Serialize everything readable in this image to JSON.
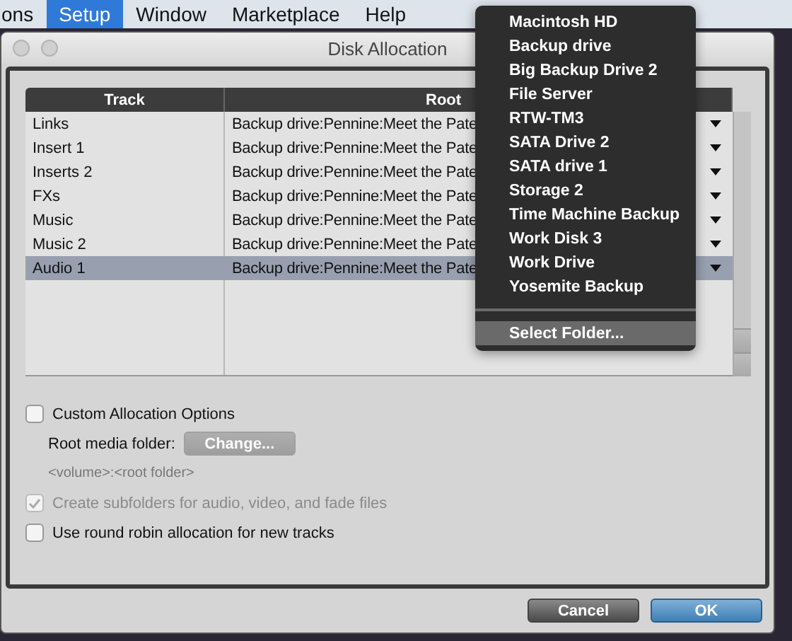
{
  "menu_bar": {
    "items": [
      {
        "label": "ons",
        "selected": false
      },
      {
        "label": "Setup",
        "selected": true
      },
      {
        "label": "Window",
        "selected": false
      },
      {
        "label": "Marketplace",
        "selected": false
      },
      {
        "label": "Help",
        "selected": false
      }
    ]
  },
  "window": {
    "title": "Disk Allocation"
  },
  "table": {
    "columns": [
      "Track",
      "Root"
    ],
    "rows": [
      {
        "track": "Links",
        "root": "Backup drive:Pennine:Meet the Pate",
        "selected": false
      },
      {
        "track": "Insert 1",
        "root": "Backup drive:Pennine:Meet the Pate",
        "selected": false
      },
      {
        "track": "Inserts 2",
        "root": "Backup drive:Pennine:Meet the Pate",
        "selected": false
      },
      {
        "track": "FXs",
        "root": "Backup drive:Pennine:Meet the Pate",
        "selected": false
      },
      {
        "track": "Music",
        "root": "Backup drive:Pennine:Meet the Pate",
        "selected": false
      },
      {
        "track": "Music 2",
        "root": "Backup drive:Pennine:Meet the Pate",
        "selected": false
      },
      {
        "track": "Audio 1",
        "root": "Backup drive:Pennine:Meet the Pate",
        "selected": true
      }
    ]
  },
  "options": [
    {
      "kind": "checkbox",
      "label": "Custom Allocation Options",
      "checked": false,
      "disabled": false
    },
    {
      "kind": "folder",
      "label": "Root media folder:",
      "button": "Change...",
      "disabled": true
    },
    {
      "kind": "hint",
      "label": "<volume>:<root folder>"
    },
    {
      "kind": "checkbox",
      "label": "Create subfolders for audio, video, and fade files",
      "checked": true,
      "disabled": true
    },
    {
      "kind": "checkbox",
      "label": "Use round robin allocation for new tracks",
      "checked": false,
      "disabled": false
    }
  ],
  "buttons": [
    {
      "label": "Cancel",
      "kind": "normal"
    },
    {
      "label": "OK",
      "kind": "primary"
    }
  ],
  "popup_menu": {
    "items": [
      {
        "label": "Macintosh HD",
        "highlighted": false
      },
      {
        "label": "Backup drive",
        "highlighted": false
      },
      {
        "label": "Big Backup Drive 2",
        "highlighted": false
      },
      {
        "label": "File Server",
        "highlighted": false
      },
      {
        "label": "RTW-TM3",
        "highlighted": false
      },
      {
        "label": "SATA Drive 2",
        "highlighted": false
      },
      {
        "label": "SATA drive 1",
        "highlighted": false
      },
      {
        "label": "Storage 2",
        "highlighted": false
      },
      {
        "label": "Time Machine Backup",
        "highlighted": false
      },
      {
        "label": "Work Disk 3",
        "highlighted": false
      },
      {
        "label": "Work Drive",
        "highlighted": false
      },
      {
        "label": "Yosemite Backup",
        "highlighted": false
      }
    ],
    "footer_items": [
      {
        "label": "Select Folder...",
        "highlighted": true
      }
    ]
  }
}
